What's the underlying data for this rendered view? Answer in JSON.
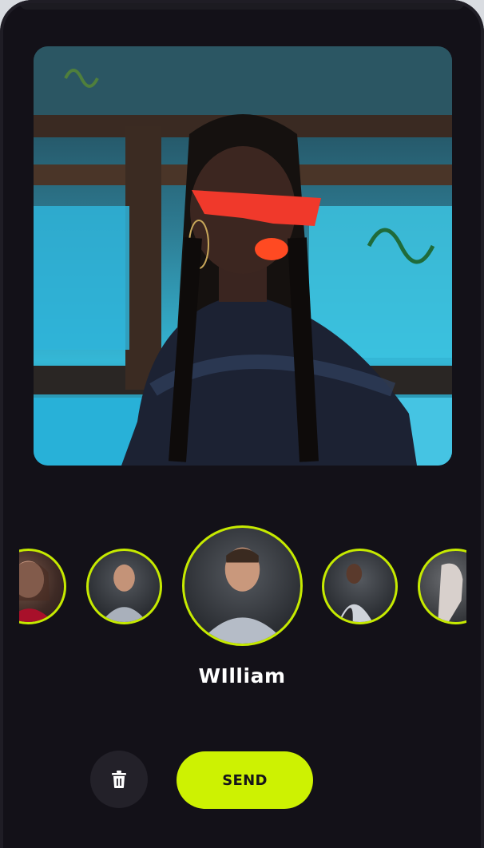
{
  "screen": {
    "selected_name": "WIlliam",
    "send_label": "SEND"
  },
  "carousel": {
    "items": [
      {
        "id": "woman-red-top",
        "selected": true
      },
      {
        "id": "man-shirt-small",
        "selected": true
      },
      {
        "id": "william",
        "selected": true,
        "active": true
      },
      {
        "id": "man-jacket",
        "selected": true
      },
      {
        "id": "woman-profile",
        "selected": true
      }
    ]
  },
  "icons": {
    "delete": "trash-icon",
    "check": "check-icon"
  },
  "colors": {
    "accent": "#cdf202",
    "background": "#131118",
    "ring": "#c6ea00",
    "button_dark": "#232129"
  }
}
